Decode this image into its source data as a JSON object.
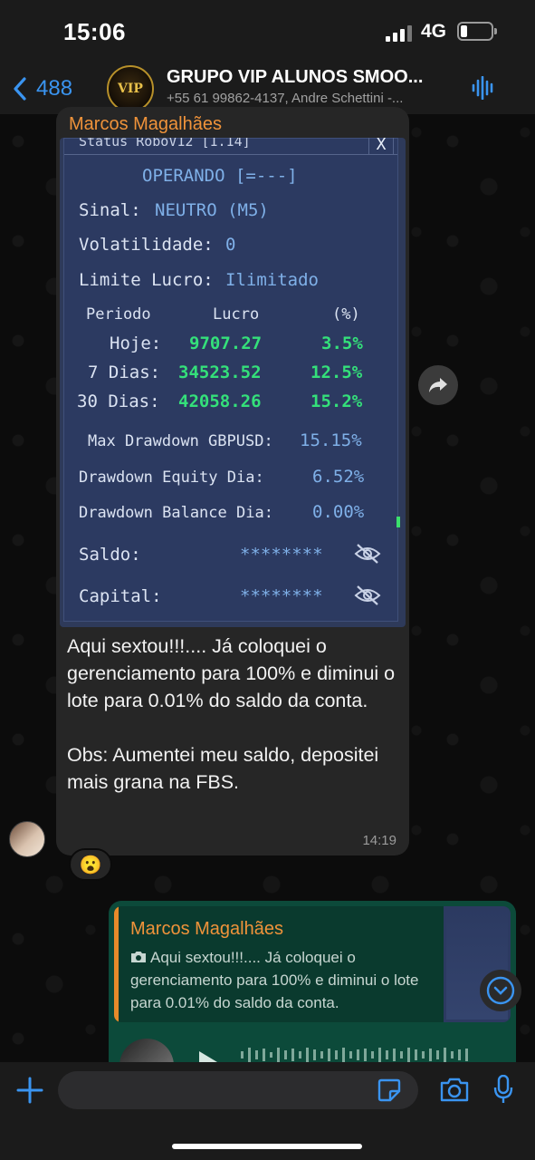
{
  "status_bar": {
    "time": "15:06",
    "network": "4G"
  },
  "header": {
    "back_count": "488",
    "avatar_text": "VIP",
    "title": "GRUPO VIP ALUNOS SMOO...",
    "subtitle": "+55 61 99862-4137, Andre Schettini -..."
  },
  "message1": {
    "sender": "Marcos Magalhães",
    "image": {
      "title": "Status RoboV12 [1.14]",
      "close": "X",
      "status": "OPERANDO [=---]",
      "signal_label": "Sinal:",
      "signal_value": "NEUTRO (M5)",
      "vol_label": "Volatilidade:",
      "vol_value": "0",
      "limit_label": "Limite Lucro:",
      "limit_value": "Ilimitado",
      "col_period": "Periodo",
      "col_profit": "Lucro",
      "col_pct": "(%)",
      "rows": [
        {
          "period": "Hoje:",
          "profit": "9707.27",
          "pct": "3.5%"
        },
        {
          "period": "7 Dias:",
          "profit": "34523.52",
          "pct": "12.5%"
        },
        {
          "period": "30 Dias:",
          "profit": "42058.26",
          "pct": "15.2%"
        }
      ],
      "max_dd_label": "Max Drawdown GBPUSD:",
      "max_dd_value": "15.15%",
      "dd_equity_label": "Drawdown Equity Dia:",
      "dd_equity_value": "6.52%",
      "dd_balance_label": "Drawdown Balance Dia:",
      "dd_balance_value": "0.00%",
      "saldo_label": "Saldo:",
      "saldo_value": "********",
      "capital_label": "Capital:",
      "capital_value": "********"
    },
    "text": "Aqui sextou!!!.... Já coloquei o gerenciamento para 100% e diminui o lote para 0.01% do saldo da conta.\n\nObs: Aumentei meu saldo, depositei mais grana na FBS.",
    "time": "14:19",
    "reaction": "😮"
  },
  "message2": {
    "quote_sender": "Marcos Magalhães",
    "quote_text": "Aqui sextou!!!.... Já coloquei o gerenciamento para 100% e diminui o lote para 0.01% do saldo da conta."
  },
  "input": {
    "placeholder": ""
  },
  "colors": {
    "accent": "#3a94f0",
    "sender": "#f0933a",
    "outgoing": "#0c4a3a",
    "incoming": "#262626"
  }
}
